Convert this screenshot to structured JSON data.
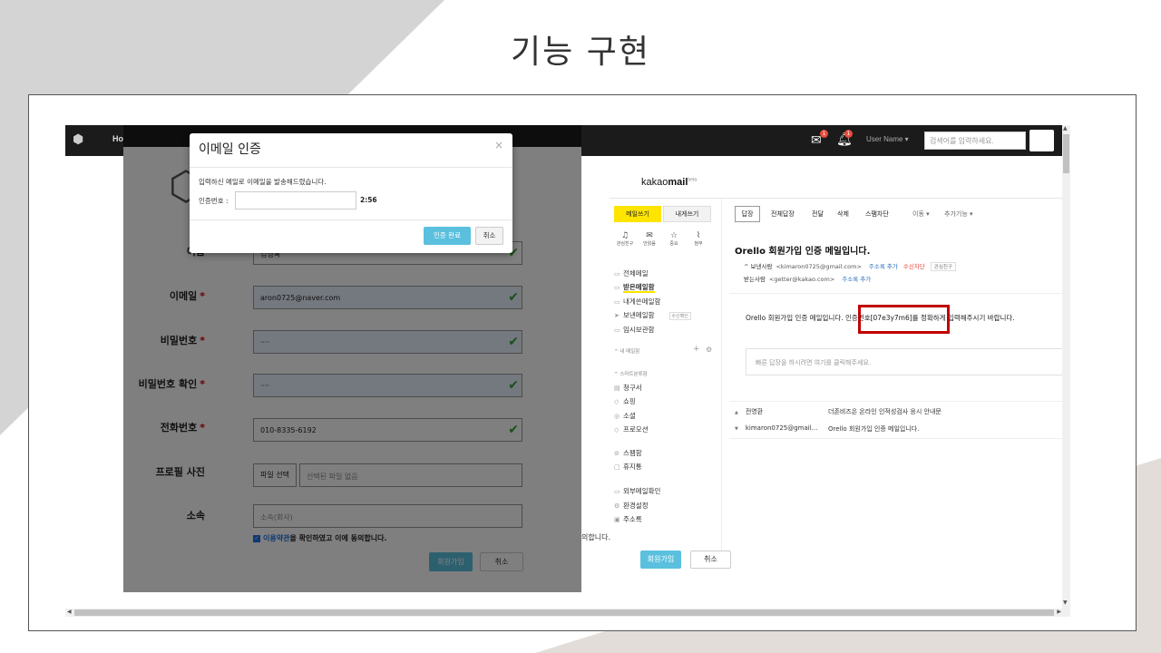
{
  "slide": {
    "title": "기능 구현"
  },
  "navbar": {
    "home": "Ho",
    "mail_badge": "1",
    "bell_badge": "1",
    "user": "User Name ▾",
    "search_placeholder": "검색어를 입력하세요."
  },
  "kakaomail": {
    "logo_bold": "mail",
    "logo_pre": "kakao",
    "logo_sup": "beta",
    "write": "메일쓰기",
    "to_self": "내게쓰기",
    "quick": [
      "관심친구",
      "안읽음",
      "중요",
      "첨부"
    ],
    "folders": [
      "전체메일",
      "받은메일함",
      "내게쓴메일함",
      "보낸메일함",
      "임시보관함"
    ],
    "sent_tag": "수신확인",
    "my_folders": "^ 내 메일함",
    "smart_label": "^ 스마트분류함",
    "smart": [
      "청구서",
      "쇼핑",
      "소셜",
      "프로모션"
    ],
    "misc": [
      "스팸함",
      "휴지통"
    ],
    "tools": [
      "외부메일확인",
      "환경설정",
      "주소록"
    ],
    "toolbar": [
      "답장",
      "전체답장",
      "전달",
      "삭제",
      "스팸차단",
      "이동 ▾",
      "추가기능 ▾"
    ],
    "mail_title": "Orello 회원가입 인증 메일입니다.",
    "from_label": "^ 보낸사람",
    "from": "<kimaron0725@gmail.com>",
    "add_contact": "주소록 추가",
    "block": "수신차단",
    "fav_chip": "관심친구",
    "to_label": "받는사람",
    "to": "<getter@kakao.com>",
    "body": "Orello 회원가입 인증 메일입니다. 인증번호[07e3y7m6]를 정확하게 입력해주시기 바랍니다.",
    "quick_reply": "빠른 답장을 하시려면 여기를 클릭해주세요.",
    "threads": [
      {
        "caret": "▲",
        "from": "전영환",
        "subject": "더존비즈온 온라인 인적성검사 응시 안내문"
      },
      {
        "caret": "▼",
        "from": "kimaron0725@gmail...",
        "subject": "Orello 회원가입 인증 메일입니다."
      }
    ]
  },
  "behind": {
    "agree_tail": "의합니다.",
    "join": "회원가입",
    "cancel": "취소"
  },
  "form": {
    "labels": [
      "이름",
      "이메일",
      "비밀번호",
      "비밀번호 확인",
      "전화번호",
      "프로필 사진",
      "소속"
    ],
    "name_value": "김영록",
    "email_value": "aron0725@naver.com",
    "password_value": "····",
    "password_confirm_value": "····",
    "phone_value": "010-8335-6192",
    "file_button": "파일 선택",
    "file_placeholder": "선택된 파일 없음",
    "org_placeholder": "소속(회사)",
    "agree_link": "이용약관",
    "agree_rest": "을 확인하였고 이에 동의합니다.",
    "join": "회원가입",
    "cancel": "취소"
  },
  "modal": {
    "title": "이메일 인증",
    "close": "×",
    "message": "입력하신 메일로 이메일을 발송해드렸습니다.",
    "code_label": "인증번호 :",
    "timer": "2:56",
    "ok": "인증 완료",
    "cancel": "취소"
  }
}
